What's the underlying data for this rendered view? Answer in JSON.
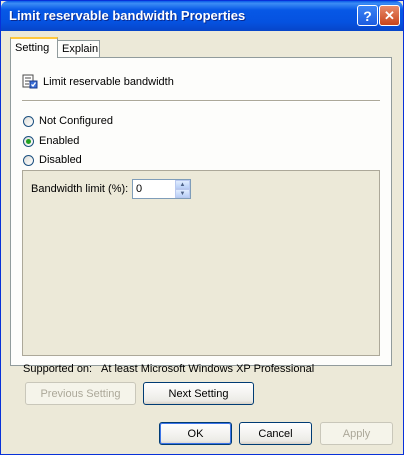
{
  "window": {
    "title": "Limit reservable bandwidth Properties",
    "help_glyph": "?",
    "close_glyph": "✕"
  },
  "tabs": [
    {
      "label": "Setting",
      "active": true
    },
    {
      "label": "Explain",
      "active": false
    }
  ],
  "policy": {
    "icon": "policy-setting-icon",
    "title": "Limit reservable bandwidth"
  },
  "radio_options": [
    {
      "label": "Not Configured",
      "checked": false
    },
    {
      "label": "Enabled",
      "checked": true
    },
    {
      "label": "Disabled",
      "checked": false
    }
  ],
  "options": {
    "bandwidth_label": "Bandwidth limit (%):",
    "bandwidth_value": "0",
    "up_glyph": "▲",
    "down_glyph": "▼"
  },
  "supported": {
    "label": "Supported on:",
    "value": "At least Microsoft Windows XP Professional"
  },
  "navigation": {
    "previous_label": "Previous Setting",
    "next_label": "Next Setting"
  },
  "footer": {
    "ok_label": "OK",
    "cancel_label": "Cancel",
    "apply_label": "Apply"
  },
  "colors": {
    "titlebar": "#0758e6",
    "dialog_bg": "#ece9d8",
    "tab_highlight": "#ffc83c",
    "radio_dot": "#21a121"
  }
}
